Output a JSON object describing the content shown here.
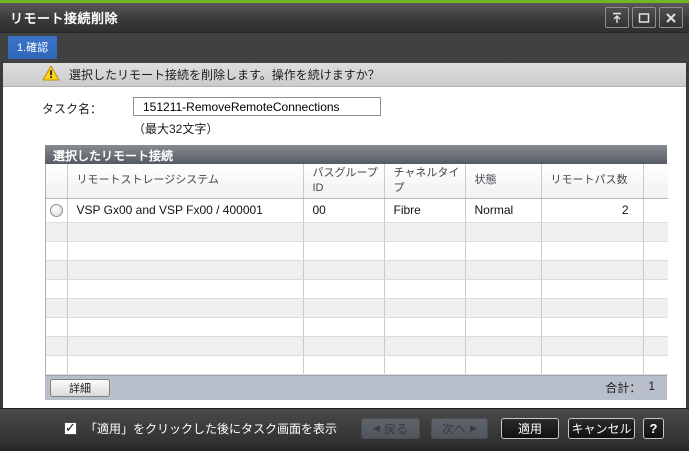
{
  "window": {
    "title": "リモート接続削除"
  },
  "steps": {
    "current": "1.確認"
  },
  "warning": {
    "message": "選択したリモート接続を削除します。操作を続けますか？"
  },
  "task": {
    "label": "タスク名：",
    "value": "151211-RemoveRemoteConnections",
    "hint": "（最大32文字）"
  },
  "table": {
    "title": "選択したリモート接続",
    "columns": [
      "リモートストレージシステム",
      "パスグループID",
      "チャネルタイプ",
      "状態",
      "リモートパス数"
    ],
    "rows": [
      {
        "storage_system": "VSP Gx00 and VSP Fx00 / 400001",
        "path_group_id": "00",
        "channel_type": "Fibre",
        "status": "Normal",
        "remote_path_count": "2"
      }
    ],
    "empty_row_count": 8,
    "detail_button": "詳細",
    "total_label": "合計：",
    "total_value": "1"
  },
  "footer": {
    "checkbox_label": "「適用」をクリックした後にタスク画面を表示",
    "checkbox_checked": true,
    "back_label": "戻る",
    "next_label": "次へ",
    "apply_label": "適用",
    "cancel_label": "キャンセル",
    "help_label": "?"
  },
  "colors": {
    "accent_green": "#72b626",
    "tab_blue": "#2f66b8",
    "warning_yellow": "#ffd21e"
  }
}
